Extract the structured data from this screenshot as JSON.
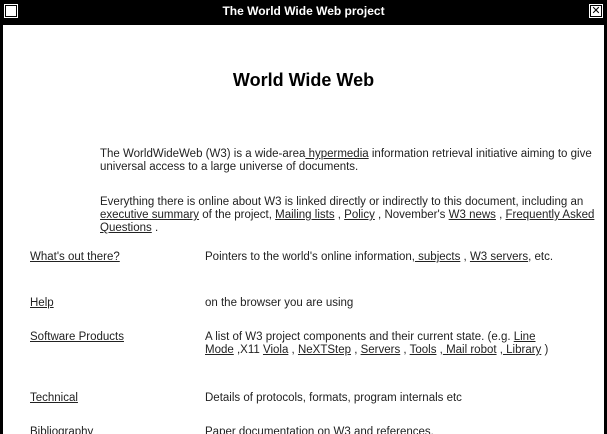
{
  "window": {
    "title": "The World Wide Web project"
  },
  "page": {
    "heading": "World Wide Web",
    "p1": {
      "t1": "The WorldWideWeb (W3) is a wide-area",
      "link_hypermedia": " hypermedia",
      "t2": " information retrieval initiative aiming to give universal access to a large universe of documents."
    },
    "p2": {
      "t1": "Everything there is online about W3 is linked directly or indirectly to this document, including an ",
      "link_summary": "executive summary",
      "t2": " of the project, ",
      "link_mailing": "Mailing lists",
      "t3": " , ",
      "link_policy": "Policy",
      "t4": " , November's ",
      "link_w3news": "W3 news",
      "t5": " , ",
      "link_faq": "Frequently Asked Questions",
      "t6": " ."
    },
    "rows": {
      "whats_out": {
        "term": "What's out there?",
        "d1": "Pointers to the world's online information,",
        "link_subjects": " subjects",
        "d2": " , ",
        "link_w3servers": "W3 servers",
        "d3": ", etc."
      },
      "help": {
        "term": "Help",
        "def": "on the browser you are using"
      },
      "software": {
        "term": "Software Products",
        "d1": "A list of W3 project components and their current state. (e.g. ",
        "link_linemode": "Line Mode",
        "d2": " ,X11 ",
        "link_viola": "Viola",
        "d3": " , ",
        "link_nextstep": "NeXTStep",
        "d4": " , ",
        "link_servers": "Servers",
        "d5": " , ",
        "link_tools": "Tools",
        "d6": " ,",
        "link_mailrobot": " Mail robot",
        "d7": " ,",
        "link_library": " Library",
        "d8": " )"
      },
      "technical": {
        "term": "Technical",
        "def": "Details of protocols, formats, program internals etc"
      },
      "bibliography": {
        "term": "Bibliography",
        "def": "Paper documentation on W3 and references."
      }
    }
  }
}
